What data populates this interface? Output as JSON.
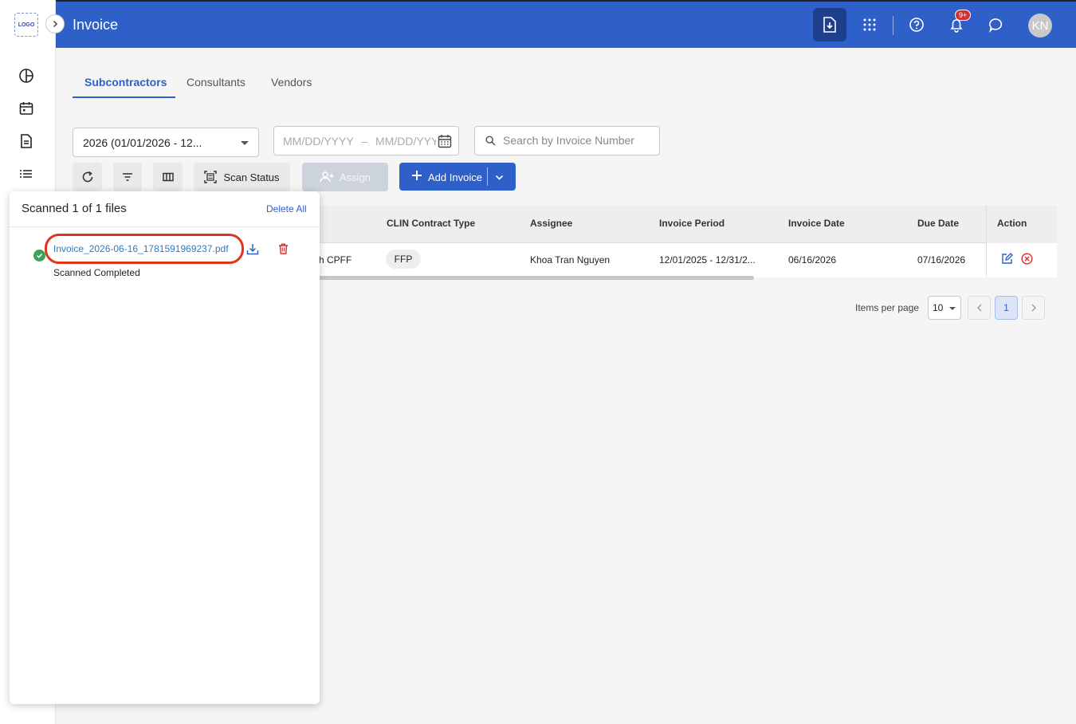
{
  "logo_text": "LOGO",
  "header": {
    "title": "Invoice",
    "notification_badge": "9+",
    "avatar_initials": "KN"
  },
  "tabs": [
    {
      "label": "Subcontractors",
      "active": true
    },
    {
      "label": "Consultants",
      "active": false
    },
    {
      "label": "Vendors",
      "active": false
    }
  ],
  "filters": {
    "period_value": "2026 (01/01/2026 - 12...",
    "date_start_placeholder": "MM/DD/YYYY",
    "date_separator": "–",
    "date_end_placeholder": "MM/DD/YYYY",
    "search_placeholder": "Search by Invoice Number"
  },
  "toolbar": {
    "scan_status_label": "Scan Status",
    "assign_label": "Assign",
    "add_invoice_label": "Add Invoice"
  },
  "table": {
    "columns": [
      "CLIN Contract Type",
      "Assignee",
      "Invoice Period",
      "Invoice Date",
      "Due Date",
      "Action"
    ],
    "rows": [
      {
        "contract_type_fragment": "h CPFF",
        "clin_contract_type": "FFP",
        "assignee": "Khoa Tran Nguyen",
        "invoice_period": "12/01/2025 - 12/31/2...",
        "invoice_date": "06/16/2026",
        "due_date": "07/16/2026"
      }
    ]
  },
  "pagination": {
    "items_per_page_label": "Items per page",
    "items_per_page_value": "10",
    "current_page": "1"
  },
  "scan_panel": {
    "title": "Scanned 1 of 1 files",
    "delete_all_label": "Delete All",
    "files": [
      {
        "name": "Invoice_2026-06-16_1781591969237.pdf",
        "status": "Scanned Completed"
      }
    ]
  },
  "colors": {
    "primary": "#2f5fc9",
    "highlight_ring": "#e2331f",
    "success": "#3aa357",
    "danger": "#d32f2f"
  }
}
